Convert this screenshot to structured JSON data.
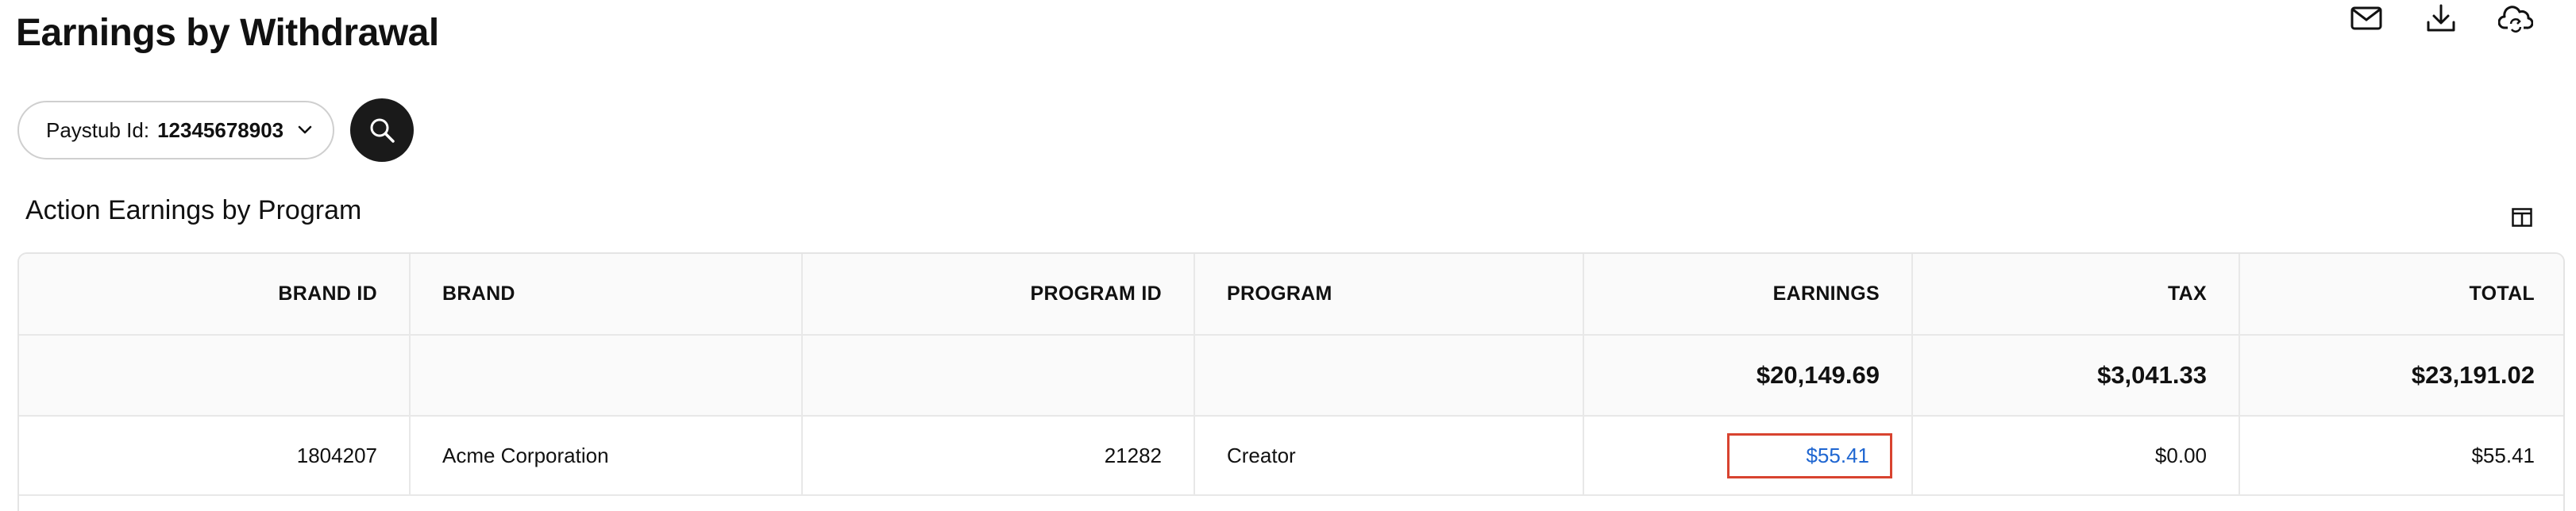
{
  "page": {
    "title": "Earnings by Withdrawal"
  },
  "top_actions": [
    {
      "icon": "mail-icon"
    },
    {
      "icon": "download-icon"
    },
    {
      "icon": "cloud-sync-icon"
    }
  ],
  "filter": {
    "label": "Paystub Id:",
    "value": "12345678903",
    "search_icon": "search-icon"
  },
  "section": {
    "title": "Action Earnings by Program",
    "columns_icon": "columns-icon"
  },
  "table": {
    "headers": [
      "BRAND ID",
      "BRAND",
      "PROGRAM ID",
      "PROGRAM",
      "EARNINGS",
      "TAX",
      "TOTAL"
    ],
    "totals": {
      "earnings": "$20,149.69",
      "tax": "$3,041.33",
      "total": "$23,191.02"
    },
    "rows": [
      {
        "brand_id": "1804207",
        "brand": "Acme Corporation",
        "program_id": "21282",
        "program": "Creator",
        "earnings": "$55.41",
        "tax": "$0.00",
        "total": "$55.41"
      }
    ]
  },
  "colors": {
    "link": "#1f66d1",
    "highlight_border": "#d8432f",
    "search_button_bg": "#1a1a1a"
  }
}
